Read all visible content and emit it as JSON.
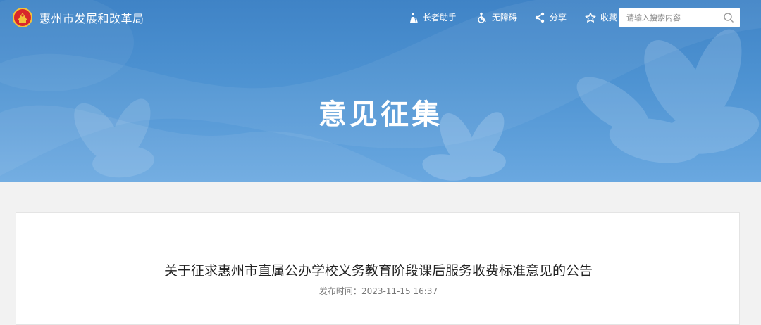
{
  "header": {
    "site_name": "惠州市发展和改革局",
    "tools": {
      "elder": "长者助手",
      "accessibility": "无障碍",
      "share": "分享",
      "favorite": "收藏"
    },
    "search": {
      "placeholder": "请输入搜索内容"
    }
  },
  "banner": {
    "title": "意见征集"
  },
  "article": {
    "title": "关于征求惠州市直属公办学校义务教育阶段课后服务收费标准意见的公告",
    "publish_label": "发布时间：",
    "publish_time": "2023-11-15 16:37"
  },
  "colors": {
    "banner_top": "#3f83c6",
    "banner_bottom": "#6aa8e0",
    "page_bg": "#f2f2f2",
    "emblem_red": "#d8262b",
    "emblem_gold": "#f3c23a"
  },
  "icons": {
    "emblem": "national-emblem-icon",
    "elder": "elder-assistant-icon",
    "accessibility": "wheelchair-icon",
    "share": "share-icon",
    "favorite": "star-icon",
    "search": "search-icon"
  }
}
